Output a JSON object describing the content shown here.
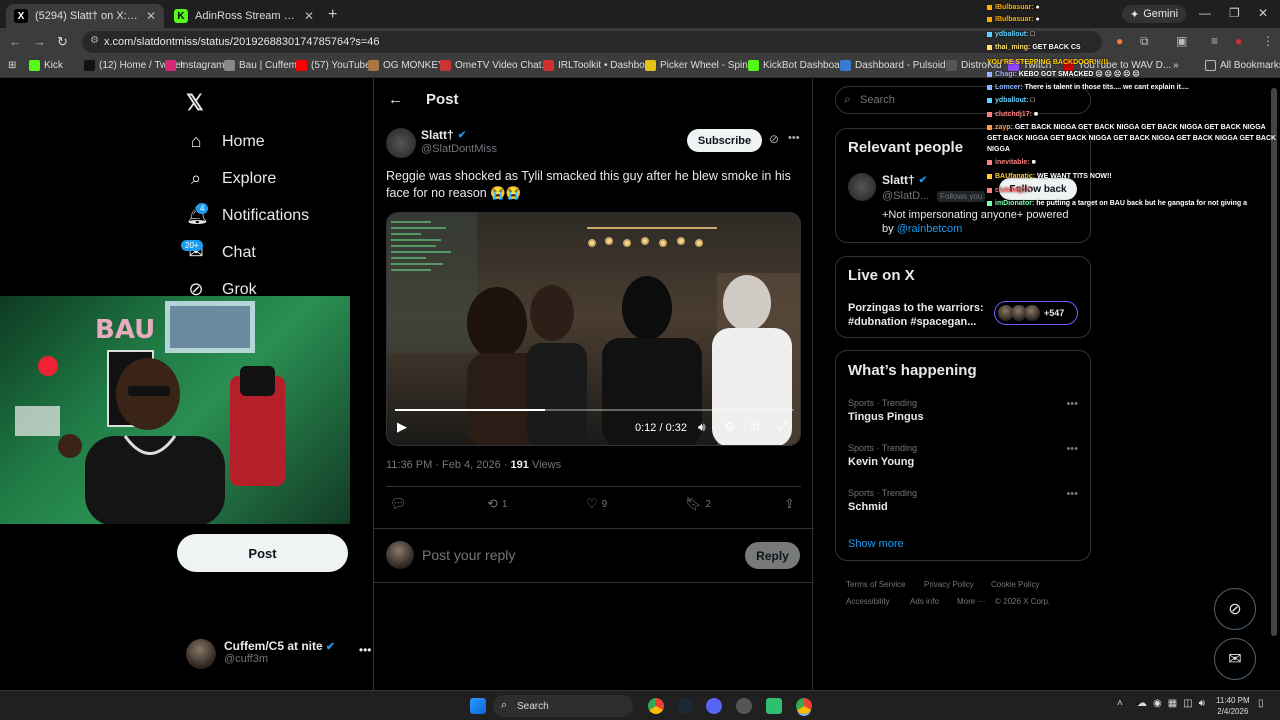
{
  "tabs": [
    {
      "title": "(5294) Slatt† on X: \"Reggie was",
      "favicon": "x-icon"
    },
    {
      "title": "AdinRoss Stream - Watch Live o",
      "favicon": "kick-icon"
    }
  ],
  "gemini_label": "Gemini",
  "url": "x.com/slatdontmiss/status/2019268830174785764?s=46",
  "bookmarks": [
    {
      "label": "Kick",
      "color": "#53fc18"
    },
    {
      "label": "(12) Home / Twitter",
      "color": "#111"
    },
    {
      "label": "Instagram",
      "color": "#d62976"
    },
    {
      "label": "Bau | Cuffem",
      "color": "#888"
    },
    {
      "label": "(57) YouTube",
      "color": "#ff0000"
    },
    {
      "label": "OG MONKEY",
      "color": "#aa7744"
    },
    {
      "label": "OmeTV Video Chat...",
      "color": "#cc3333"
    },
    {
      "label": "IRLToolkit • Dashbo...",
      "color": "#d03030"
    },
    {
      "label": "Picker Wheel - Spin...",
      "color": "#e6c319"
    },
    {
      "label": "KickBot Dashboard",
      "color": "#53fc18"
    },
    {
      "label": "Dashboard - Pulsoid",
      "color": "#3a7bd5"
    },
    {
      "label": "DistroKid",
      "color": "#555"
    },
    {
      "label": "Twitch",
      "color": "#9146ff"
    },
    {
      "label": "YouTube to WAV D...",
      "color": "#c00"
    }
  ],
  "all_bookmarks": "All Bookmarks",
  "sidebar": {
    "items": [
      {
        "label": "Home",
        "icon": "home-icon",
        "glyph": "⌂"
      },
      {
        "label": "Explore",
        "icon": "search-icon",
        "glyph": "⌕"
      },
      {
        "label": "Notifications",
        "icon": "bell-icon",
        "glyph": "☀",
        "badge": "4"
      },
      {
        "label": "Chat",
        "icon": "chat-icon",
        "glyph": "✉",
        "badge": "20+"
      },
      {
        "label": "Grok",
        "icon": "grok-icon",
        "glyph": "⊘"
      }
    ],
    "post_button": "Post",
    "account": {
      "name": "Cuffem/C5 at nite",
      "handle": "@cuff3m"
    }
  },
  "header": {
    "back": "←",
    "title": "Post"
  },
  "post": {
    "author": "Slatt†",
    "handle": "@SlatDontMiss",
    "subscribe": "Subscribe",
    "text": "Reggie was shocked as Tylil smacked this guy after he blew smoke in his face for no reason 😭😭",
    "video_time": "0:12 / 0:32",
    "video_progress": 0.375,
    "timestamp": "11:36 PM · Feb 4, 2026 ·",
    "views_count": "191",
    "views_label": "Views",
    "reposts": "1",
    "likes": "9",
    "bookmarks": "2"
  },
  "reply": {
    "placeholder": "Post your reply",
    "button": "Reply"
  },
  "right": {
    "search_placeholder": "Search",
    "relevant_title": "Relevant people",
    "person": {
      "name": "Slatt†",
      "handle": "@SlatD...",
      "follows_you": "Follows you",
      "bio_pre": "+Not impersonating anyone+ powered by",
      "bio_link": "@rainbetcom",
      "follow_back": "Follow back"
    },
    "live_title": "Live on X",
    "live_text": "Porzingas to the warriors: #dubnation #spacegan...",
    "live_count": "+547",
    "happening_title": "What’s happening",
    "trends": [
      {
        "category": "Sports · Trending",
        "name": "Tingus Pingus"
      },
      {
        "category": "Sports · Trending",
        "name": "Kevin Young"
      },
      {
        "category": "Sports · Trending",
        "name": "Schmid"
      }
    ],
    "show_more": "Show more",
    "footer": [
      "Terms of Service",
      "Privacy Policy",
      "Cookie Policy",
      "Accessibility",
      "Ads info",
      "More ···",
      "© 2026 X Corp."
    ]
  },
  "chat": [
    {
      "user": "IBulbasuar:",
      "msg": "●",
      "color": "#ffb000"
    },
    {
      "user": "IBulbasuar:",
      "msg": "●",
      "color": "#ffb000"
    },
    {
      "user": "ydballout:",
      "msg": "□",
      "color": "#5fd3ff"
    },
    {
      "user": "thai_ming:",
      "msg": "GET BACK CS",
      "color": "#ffe270"
    },
    {
      "user": "Chagi:",
      "msg": "KEBO GOT SMACKED ☹ ☹ ☹ ☹ ☹",
      "color": "#9ab4ff"
    },
    {
      "user": "Lomcer:",
      "msg": "There is talent in those tits.... we cant explain it....",
      "color": "#8fb3ff"
    },
    {
      "user": "ydballout:",
      "msg": "□",
      "color": "#5fd3ff"
    },
    {
      "user": "clutchdj17:",
      "msg": "■",
      "color": "#ff8080"
    },
    {
      "user": "zayp:",
      "msg": "GET BACK NIGGA GET BACK NIGGA GET BACK NIGGA GET BACK NIGGA",
      "color": "#ff9a4a"
    },
    {
      "user": "",
      "msg": "GET BACK NIGGA GET BACK NIGGA GET BACK NIGGA GET BACK NIGGA GET BACK",
      "color": "#fff"
    },
    {
      "user": "",
      "msg": "NIGGA",
      "color": "#fff"
    },
    {
      "user": "inevitable:",
      "msg": "■",
      "color": "#ff8080"
    },
    {
      "user": "BAUfanatic:",
      "msg": "WE WANT TITS NOW!!",
      "color": "#ffcc33"
    },
    {
      "user": "clutchdj17:",
      "msg": "",
      "color": "#ff8080"
    },
    {
      "user": "imDionator:",
      "msg": "he putting a target on BAU back but he gangsta for not giving a",
      "color": "#7fffb0"
    }
  ],
  "chat_header": "YOU'RE STEPPING BACKDOOR!!!!!!",
  "taskbar": {
    "search": "Search",
    "time": "11:40 PM",
    "date": "2/4/2026"
  }
}
